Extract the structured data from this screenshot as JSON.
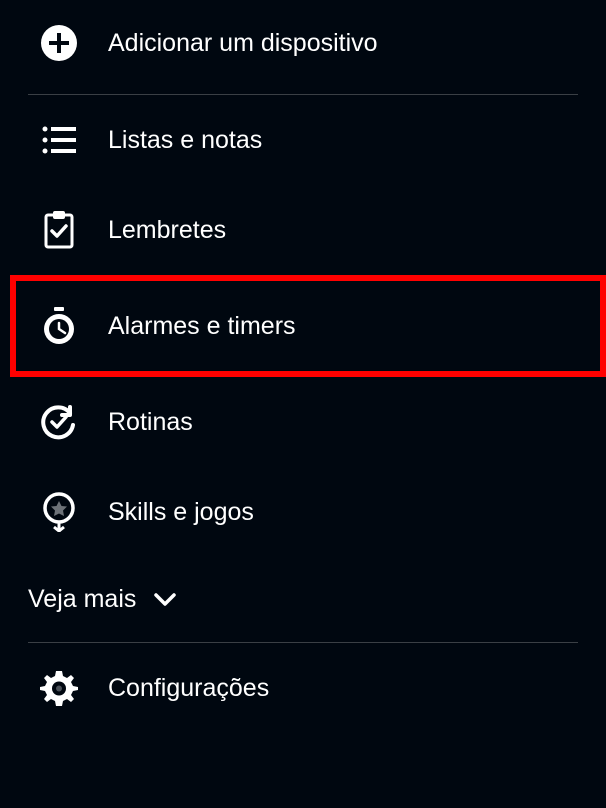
{
  "menu": {
    "add_device": "Adicionar um dispositivo",
    "lists": "Listas e notas",
    "reminders": "Lembretes",
    "alarms": "Alarmes e timers",
    "routines": "Rotinas",
    "skills": "Skills e jogos",
    "see_more": "Veja mais",
    "settings": "Configurações"
  }
}
